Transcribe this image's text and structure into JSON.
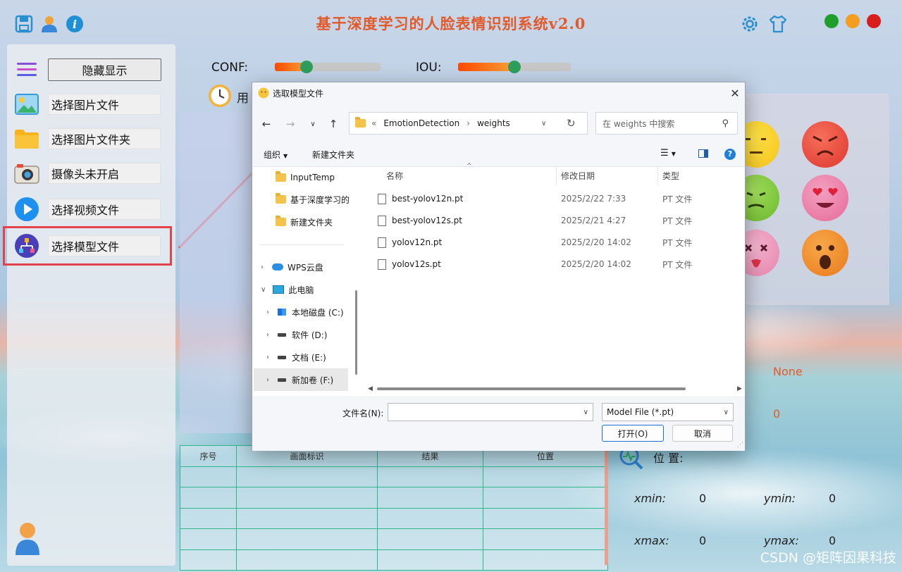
{
  "window": {
    "title": "基于深度学习的人脸表情识别系统v2.0",
    "top_icons": [
      "save-icon",
      "user-icon",
      "info-icon"
    ],
    "right_icons": [
      "settings-icon",
      "shirt-icon"
    ],
    "window_dots": {
      "green": "#1f9e2c",
      "orange": "#f59d1e",
      "red": "#d91d1d"
    }
  },
  "sidebar": {
    "toggle_label": "隐藏显示",
    "items": [
      {
        "label": "选择图片文件",
        "icon": "image-icon"
      },
      {
        "label": "选择图片文件夹",
        "icon": "folder-icon"
      },
      {
        "label": "摄像头未开启",
        "icon": "camera-icon"
      },
      {
        "label": "选择视频文件",
        "icon": "video-play-icon"
      },
      {
        "label": "选择模型文件",
        "icon": "model-icon"
      }
    ],
    "highlight_color": "#e5434c"
  },
  "sliders": {
    "conf": {
      "label": "CONF:",
      "value": 0.3
    },
    "iou": {
      "label": "IOU:",
      "value": 0.5
    }
  },
  "time_label": "用",
  "table": {
    "headers": [
      "序号",
      "画面标识",
      "结果",
      "位置"
    ],
    "rows": 5
  },
  "results": {
    "class_value": "None",
    "count_value": "0",
    "position_label": "位 置:",
    "xmin_label": "xmin:",
    "xmin": "0",
    "ymin_label": "ymin:",
    "ymin": "0",
    "xmax_label": "xmax:",
    "xmax": "0",
    "ymax_label": "ymax:",
    "ymax": "0"
  },
  "dialog": {
    "title": "选取模型文件",
    "path_prefix": "«",
    "path": [
      "EmotionDetection",
      "weights"
    ],
    "search_placeholder": "在 weights 中搜索",
    "organize_label": "组织",
    "new_folder_label": "新建文件夹",
    "nav_tree": [
      {
        "label": "InputTemp",
        "type": "folder"
      },
      {
        "label": "基于深度学习的",
        "type": "folder"
      },
      {
        "label": "新建文件夹",
        "type": "folder"
      },
      {
        "label": "WPS云盘",
        "type": "cloud"
      },
      {
        "label": "此电脑",
        "type": "pc"
      },
      {
        "label": "本地磁盘 (C:)",
        "type": "drive-c"
      },
      {
        "label": "软件 (D:)",
        "type": "drive"
      },
      {
        "label": "文档 (E:)",
        "type": "drive"
      },
      {
        "label": "新加卷 (F:)",
        "type": "drive"
      }
    ],
    "columns": {
      "name": "名称",
      "date": "修改日期",
      "type": "类型"
    },
    "files": [
      {
        "name": "best-yolov12n.pt",
        "date": "2025/2/22 7:33",
        "type": "PT 文件"
      },
      {
        "name": "best-yolov12s.pt",
        "date": "2025/2/21 4:27",
        "type": "PT 文件"
      },
      {
        "name": "yolov12n.pt",
        "date": "2025/2/20 14:02",
        "type": "PT 文件"
      },
      {
        "name": "yolov12s.pt",
        "date": "2025/2/20 14:02",
        "type": "PT 文件"
      }
    ],
    "filename_label": "文件名(N):",
    "filename_value": "",
    "filter_value": "Model File (*.pt)",
    "open_label": "打开(O)",
    "cancel_label": "取消"
  },
  "watermark": "CSDN @矩阵因果科技"
}
